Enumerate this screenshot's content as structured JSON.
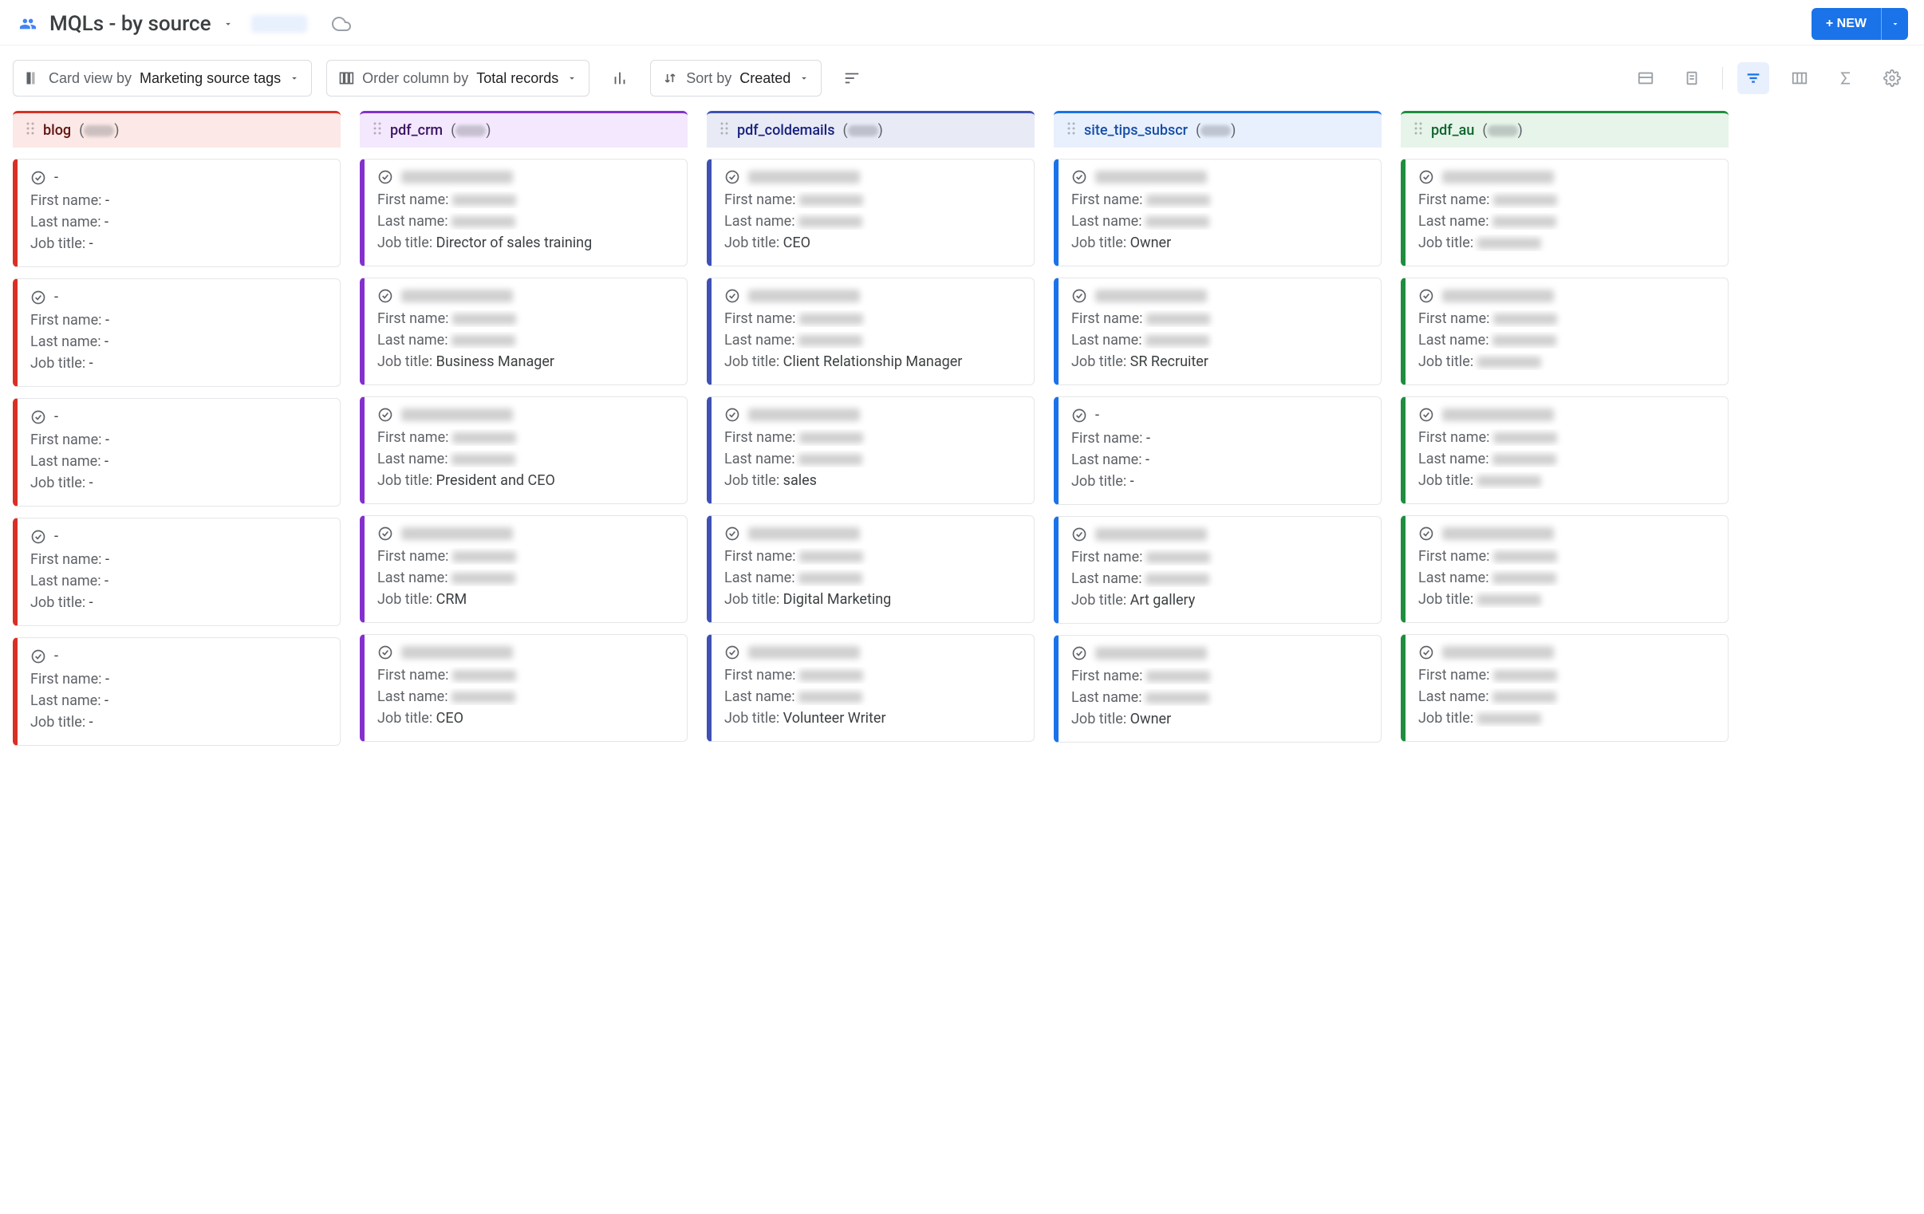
{
  "header": {
    "view_title": "MQLs - by source",
    "new_button_label": "+ NEW"
  },
  "toolbar": {
    "card_view_prefix": "Card view by ",
    "card_view_value": "Marketing source tags",
    "order_prefix": "Order column by ",
    "order_value": "Total records",
    "sort_prefix": "Sort by ",
    "sort_value": "Created"
  },
  "field_labels": {
    "first_name": "First name: ",
    "last_name": "Last name: ",
    "job_title": "Job title: "
  },
  "columns": [
    {
      "name": "blog",
      "theme": "theme-red",
      "cards": [
        {
          "title": "-",
          "first_name": "-",
          "last_name": "-",
          "job_title": "-"
        },
        {
          "title": "-",
          "first_name": "-",
          "last_name": "-",
          "job_title": "-"
        },
        {
          "title": "-",
          "first_name": "-",
          "last_name": "-",
          "job_title": "-"
        },
        {
          "title": "-",
          "first_name": "-",
          "last_name": "-",
          "job_title": "-"
        },
        {
          "title": "-",
          "first_name": "-",
          "last_name": "-",
          "job_title": "-"
        }
      ]
    },
    {
      "name": "pdf_crm",
      "theme": "theme-purple",
      "cards": [
        {
          "title": null,
          "first_name": null,
          "last_name": null,
          "job_title": "Director of sales training"
        },
        {
          "title": null,
          "first_name": null,
          "last_name": null,
          "job_title": "Business Manager"
        },
        {
          "title": null,
          "first_name": null,
          "last_name": null,
          "job_title": "President and CEO"
        },
        {
          "title": null,
          "first_name": null,
          "last_name": null,
          "job_title": "CRM"
        },
        {
          "title": null,
          "first_name": null,
          "last_name": null,
          "job_title": "CEO"
        }
      ]
    },
    {
      "name": "pdf_coldemails",
      "theme": "theme-indigo",
      "cards": [
        {
          "title": null,
          "first_name": null,
          "last_name": null,
          "job_title": "CEO"
        },
        {
          "title": null,
          "first_name": null,
          "last_name": null,
          "job_title": "Client Relationship Manager"
        },
        {
          "title": null,
          "first_name": null,
          "last_name": null,
          "job_title": "sales"
        },
        {
          "title": null,
          "first_name": null,
          "last_name": null,
          "job_title": "Digital Marketing"
        },
        {
          "title": null,
          "first_name": null,
          "last_name": null,
          "job_title": "Volunteer Writer"
        }
      ]
    },
    {
      "name": "site_tips_subscr",
      "theme": "theme-blue",
      "cards": [
        {
          "title": null,
          "first_name": null,
          "last_name": null,
          "job_title": "Owner"
        },
        {
          "title": null,
          "first_name": null,
          "last_name": null,
          "job_title": "SR Recruiter"
        },
        {
          "title": "-",
          "first_name": "-",
          "last_name": "-",
          "job_title": "-"
        },
        {
          "title": null,
          "first_name": null,
          "last_name": null,
          "job_title": "Art gallery"
        },
        {
          "title": null,
          "first_name": null,
          "last_name": null,
          "job_title": "Owner"
        }
      ]
    },
    {
      "name": "pdf_au",
      "theme": "theme-green",
      "cards": [
        {
          "title": null,
          "first_name": null,
          "last_name": null,
          "job_title": null
        },
        {
          "title": null,
          "first_name": null,
          "last_name": null,
          "job_title": null
        },
        {
          "title": null,
          "first_name": null,
          "last_name": null,
          "job_title": null
        },
        {
          "title": null,
          "first_name": null,
          "last_name": null,
          "job_title": null
        },
        {
          "title": null,
          "first_name": null,
          "last_name": null,
          "job_title": null
        }
      ]
    }
  ]
}
